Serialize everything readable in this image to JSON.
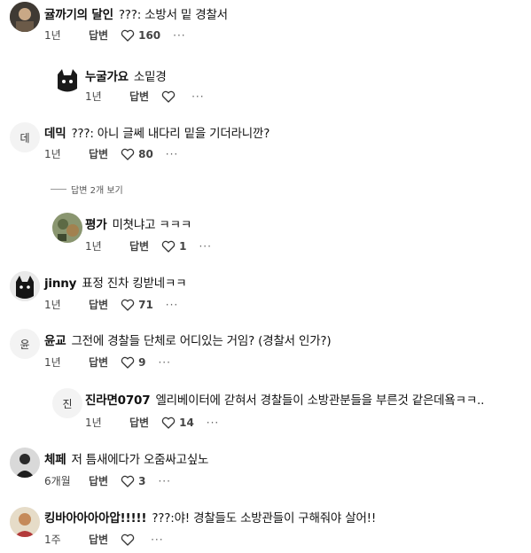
{
  "comments": [
    {
      "user": "귤까기의 달인",
      "text": "???: 소방서 밑 경찰서",
      "age": "1년",
      "reply_label": "답변",
      "likes": "160",
      "more": "···",
      "avatar_letter": ""
    },
    {
      "user": "누굴가요",
      "text": "소밑경",
      "age": "1년",
      "reply_label": "답변",
      "likes": "",
      "more": "···",
      "avatar_letter": ""
    },
    {
      "user": "데믹",
      "text": "???: 아니 글쎄 내다리 밑을 기더라니깐?",
      "age": "1년",
      "reply_label": "답변",
      "likes": "80",
      "more": "···",
      "avatar_letter": "데"
    },
    {
      "user": "평가",
      "text": "미쳣냐고 ㅋㅋㅋ",
      "age": "1년",
      "reply_label": "답변",
      "likes": "1",
      "more": "···",
      "avatar_letter": ""
    },
    {
      "user": "jinny",
      "text": "표정 진차 킹받네ㅋㅋ",
      "age": "1년",
      "reply_label": "답변",
      "likes": "71",
      "more": "···",
      "avatar_letter": ""
    },
    {
      "user": "윤교",
      "text": "그전에 경찰들 단체로 어디있는 거임? (경찰서 인가?)",
      "age": "1년",
      "reply_label": "답변",
      "likes": "9",
      "more": "···",
      "avatar_letter": "윤"
    },
    {
      "user": "진라면0707",
      "text": "엘리베이터에 갇혀서 경찰들이 소방관분들을 부른것 같은데욬ㅋㅋ..",
      "age": "1년",
      "reply_label": "답변",
      "likes": "14",
      "more": "···",
      "avatar_letter": "진"
    },
    {
      "user": "체페",
      "text": "저 틈새에다가 오줌싸고싶노",
      "age": "6개월",
      "reply_label": "답변",
      "likes": "3",
      "more": "···",
      "avatar_letter": ""
    },
    {
      "user": "킹바아아아아압!!!!!",
      "text": "???:야! 경찰들도 소방관들이 구해줘야 살어!!",
      "age": "1주",
      "reply_label": "답변",
      "likes": "",
      "more": "···",
      "avatar_letter": ""
    }
  ],
  "thread_toggle": "답변 2개 보기",
  "colors": {
    "heart": "#333333",
    "meta": "#444444"
  }
}
